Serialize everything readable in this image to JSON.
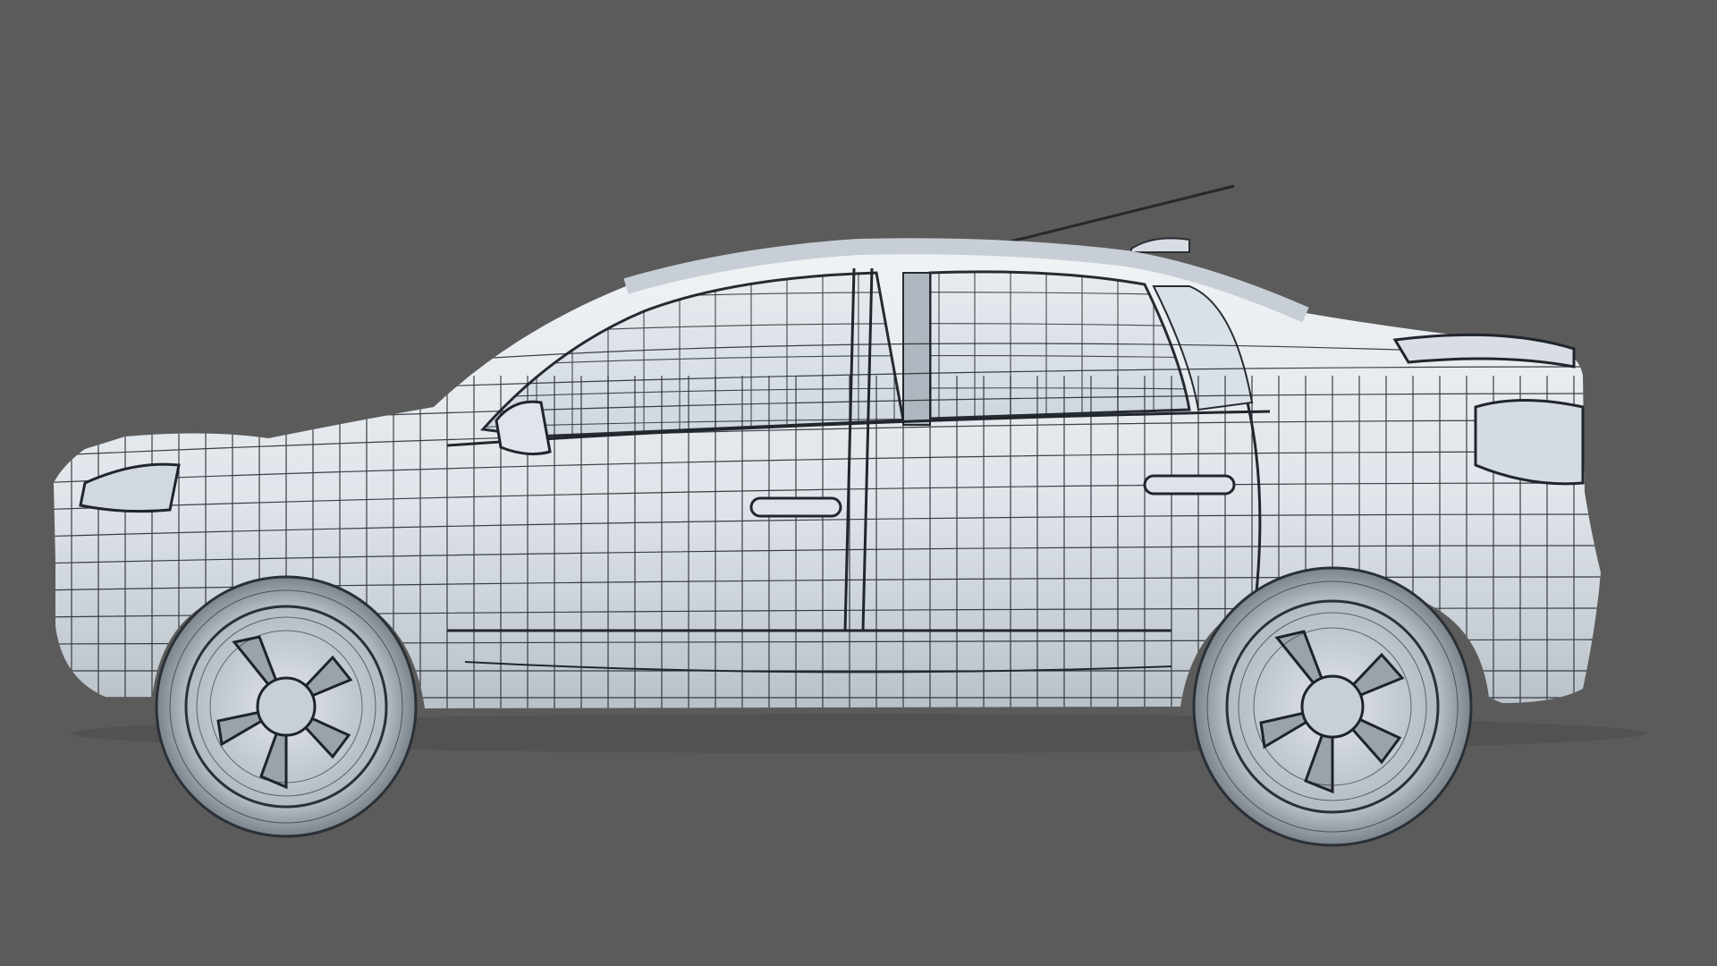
{
  "viewport": {
    "background_color": "#5b5b5b"
  },
  "model": {
    "subject": "car-side-view-wireframe",
    "body_color": "#e4e9ee",
    "wire_color": "#1d2227",
    "wheel_color": "#6c7278"
  }
}
